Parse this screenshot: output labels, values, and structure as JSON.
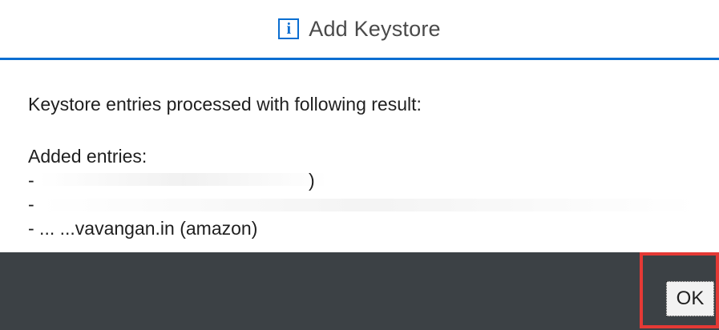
{
  "dialog": {
    "title": "Add Keystore",
    "icon": "info-icon",
    "icon_glyph": "i",
    "accent_color": "#0a6ed1"
  },
  "content": {
    "message": "Keystore entries processed with following result:",
    "section_label": "Added entries:",
    "entries": [
      "- ",
      "- ",
      "- ... ...vavangan.in (amazon)"
    ],
    "entry_1_suffix": ")"
  },
  "footer": {
    "ok_label": "OK",
    "background_color": "#3c4145",
    "highlight_color": "#e53935"
  }
}
